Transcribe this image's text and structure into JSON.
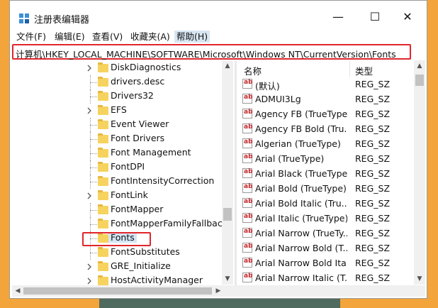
{
  "window": {
    "title": "注册表编辑器"
  },
  "controls": {
    "minimize": "—",
    "maximize": "☐",
    "close": "✕"
  },
  "menu": [
    {
      "label": "文件(F)"
    },
    {
      "label": "编辑(E)"
    },
    {
      "label": "查看(V)"
    },
    {
      "label": "收藏夹(A)"
    },
    {
      "label": "帮助(H)",
      "active": true
    }
  ],
  "address": {
    "path": "计算机\\HKEY_LOCAL_MACHINE\\SOFTWARE\\Microsoft\\Windows NT\\CurrentVersion\\Fonts"
  },
  "tree": {
    "items": [
      {
        "label": "DiskDiagnostics",
        "expandable": true
      },
      {
        "label": "drivers.desc",
        "expandable": false
      },
      {
        "label": "Drivers32",
        "expandable": false
      },
      {
        "label": "EFS",
        "expandable": true
      },
      {
        "label": "Event Viewer",
        "expandable": false
      },
      {
        "label": "Font Drivers",
        "expandable": false
      },
      {
        "label": "Font Management",
        "expandable": false
      },
      {
        "label": "FontDPI",
        "expandable": false
      },
      {
        "label": "FontIntensityCorrection",
        "expandable": false
      },
      {
        "label": "FontLink",
        "expandable": true
      },
      {
        "label": "FontMapper",
        "expandable": false
      },
      {
        "label": "FontMapperFamilyFallback",
        "expandable": false
      },
      {
        "label": "Fonts",
        "expandable": false,
        "selected": true
      },
      {
        "label": "FontSubstitutes",
        "expandable": false
      },
      {
        "label": "GRE_Initialize",
        "expandable": true
      },
      {
        "label": "HostActivityManager",
        "expandable": true
      }
    ]
  },
  "list": {
    "headers": {
      "name": "名称",
      "type": "类型"
    },
    "rows": [
      {
        "name": "(默认)",
        "type": "REG_SZ"
      },
      {
        "name": "ADMUI3Lg",
        "type": "REG_SZ"
      },
      {
        "name": "Agency FB (TrueType)",
        "type": "REG_SZ"
      },
      {
        "name": "Agency FB Bold (Tru...",
        "type": "REG_SZ"
      },
      {
        "name": "Algerian (TrueType)",
        "type": "REG_SZ"
      },
      {
        "name": "Arial (TrueType)",
        "type": "REG_SZ"
      },
      {
        "name": "Arial Black (TrueType)",
        "type": "REG_SZ"
      },
      {
        "name": "Arial Bold (TrueType)",
        "type": "REG_SZ"
      },
      {
        "name": "Arial Bold Italic (Tru...",
        "type": "REG_SZ"
      },
      {
        "name": "Arial Italic (TrueType)",
        "type": "REG_SZ"
      },
      {
        "name": "Arial Narrow (TrueTy...",
        "type": "REG_SZ"
      },
      {
        "name": "Arial Narrow Bold (T...",
        "type": "REG_SZ"
      },
      {
        "name": "Arial Narrow Bold Ita...",
        "type": "REG_SZ"
      },
      {
        "name": "Arial Narrow Italic (T...",
        "type": "REG_SZ"
      }
    ]
  },
  "icons": {
    "app": "registry-icon",
    "folder": "folder-icon",
    "value": "string-value-icon",
    "expand": "chevron-right-icon"
  },
  "colors": {
    "accent_red": "#e0262c",
    "folder": "#f6d35e",
    "selected": "#d5e5f6"
  }
}
